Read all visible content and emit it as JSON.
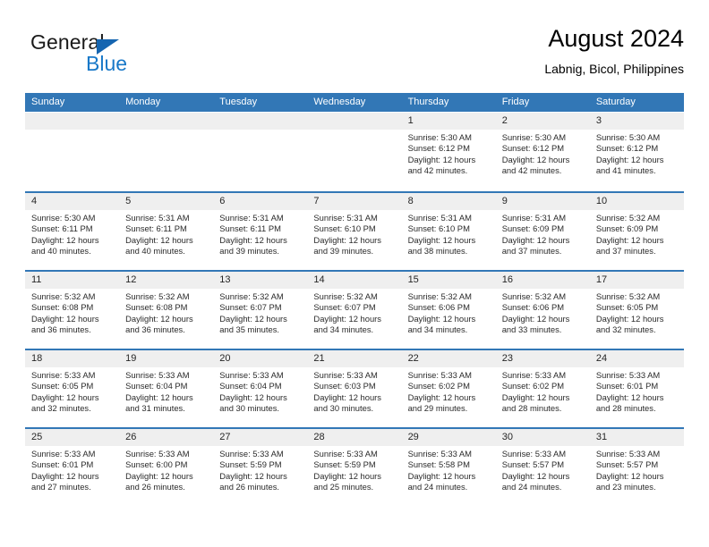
{
  "brand": {
    "word1": "General",
    "word2": "Blue",
    "triangle_icon": "triangle-icon",
    "blue": "#1878c8"
  },
  "header": {
    "title": "August 2024",
    "subtitle": "Labnig, Bicol, Philippines"
  },
  "theme": {
    "header_blue": "#3277b6",
    "day_band": "#efefef"
  },
  "weekdays": [
    "Sunday",
    "Monday",
    "Tuesday",
    "Wednesday",
    "Thursday",
    "Friday",
    "Saturday"
  ],
  "weeks": [
    [
      {
        "day": "",
        "empty": true
      },
      {
        "day": "",
        "empty": true
      },
      {
        "day": "",
        "empty": true
      },
      {
        "day": "",
        "empty": true
      },
      {
        "day": "1",
        "sunrise": "Sunrise: 5:30 AM",
        "sunset": "Sunset: 6:12 PM",
        "daylight1": "Daylight: 12 hours",
        "daylight2": "and 42 minutes."
      },
      {
        "day": "2",
        "sunrise": "Sunrise: 5:30 AM",
        "sunset": "Sunset: 6:12 PM",
        "daylight1": "Daylight: 12 hours",
        "daylight2": "and 42 minutes."
      },
      {
        "day": "3",
        "sunrise": "Sunrise: 5:30 AM",
        "sunset": "Sunset: 6:12 PM",
        "daylight1": "Daylight: 12 hours",
        "daylight2": "and 41 minutes."
      }
    ],
    [
      {
        "day": "4",
        "sunrise": "Sunrise: 5:30 AM",
        "sunset": "Sunset: 6:11 PM",
        "daylight1": "Daylight: 12 hours",
        "daylight2": "and 40 minutes."
      },
      {
        "day": "5",
        "sunrise": "Sunrise: 5:31 AM",
        "sunset": "Sunset: 6:11 PM",
        "daylight1": "Daylight: 12 hours",
        "daylight2": "and 40 minutes."
      },
      {
        "day": "6",
        "sunrise": "Sunrise: 5:31 AM",
        "sunset": "Sunset: 6:11 PM",
        "daylight1": "Daylight: 12 hours",
        "daylight2": "and 39 minutes."
      },
      {
        "day": "7",
        "sunrise": "Sunrise: 5:31 AM",
        "sunset": "Sunset: 6:10 PM",
        "daylight1": "Daylight: 12 hours",
        "daylight2": "and 39 minutes."
      },
      {
        "day": "8",
        "sunrise": "Sunrise: 5:31 AM",
        "sunset": "Sunset: 6:10 PM",
        "daylight1": "Daylight: 12 hours",
        "daylight2": "and 38 minutes."
      },
      {
        "day": "9",
        "sunrise": "Sunrise: 5:31 AM",
        "sunset": "Sunset: 6:09 PM",
        "daylight1": "Daylight: 12 hours",
        "daylight2": "and 37 minutes."
      },
      {
        "day": "10",
        "sunrise": "Sunrise: 5:32 AM",
        "sunset": "Sunset: 6:09 PM",
        "daylight1": "Daylight: 12 hours",
        "daylight2": "and 37 minutes."
      }
    ],
    [
      {
        "day": "11",
        "sunrise": "Sunrise: 5:32 AM",
        "sunset": "Sunset: 6:08 PM",
        "daylight1": "Daylight: 12 hours",
        "daylight2": "and 36 minutes."
      },
      {
        "day": "12",
        "sunrise": "Sunrise: 5:32 AM",
        "sunset": "Sunset: 6:08 PM",
        "daylight1": "Daylight: 12 hours",
        "daylight2": "and 36 minutes."
      },
      {
        "day": "13",
        "sunrise": "Sunrise: 5:32 AM",
        "sunset": "Sunset: 6:07 PM",
        "daylight1": "Daylight: 12 hours",
        "daylight2": "and 35 minutes."
      },
      {
        "day": "14",
        "sunrise": "Sunrise: 5:32 AM",
        "sunset": "Sunset: 6:07 PM",
        "daylight1": "Daylight: 12 hours",
        "daylight2": "and 34 minutes."
      },
      {
        "day": "15",
        "sunrise": "Sunrise: 5:32 AM",
        "sunset": "Sunset: 6:06 PM",
        "daylight1": "Daylight: 12 hours",
        "daylight2": "and 34 minutes."
      },
      {
        "day": "16",
        "sunrise": "Sunrise: 5:32 AM",
        "sunset": "Sunset: 6:06 PM",
        "daylight1": "Daylight: 12 hours",
        "daylight2": "and 33 minutes."
      },
      {
        "day": "17",
        "sunrise": "Sunrise: 5:32 AM",
        "sunset": "Sunset: 6:05 PM",
        "daylight1": "Daylight: 12 hours",
        "daylight2": "and 32 minutes."
      }
    ],
    [
      {
        "day": "18",
        "sunrise": "Sunrise: 5:33 AM",
        "sunset": "Sunset: 6:05 PM",
        "daylight1": "Daylight: 12 hours",
        "daylight2": "and 32 minutes."
      },
      {
        "day": "19",
        "sunrise": "Sunrise: 5:33 AM",
        "sunset": "Sunset: 6:04 PM",
        "daylight1": "Daylight: 12 hours",
        "daylight2": "and 31 minutes."
      },
      {
        "day": "20",
        "sunrise": "Sunrise: 5:33 AM",
        "sunset": "Sunset: 6:04 PM",
        "daylight1": "Daylight: 12 hours",
        "daylight2": "and 30 minutes."
      },
      {
        "day": "21",
        "sunrise": "Sunrise: 5:33 AM",
        "sunset": "Sunset: 6:03 PM",
        "daylight1": "Daylight: 12 hours",
        "daylight2": "and 30 minutes."
      },
      {
        "day": "22",
        "sunrise": "Sunrise: 5:33 AM",
        "sunset": "Sunset: 6:02 PM",
        "daylight1": "Daylight: 12 hours",
        "daylight2": "and 29 minutes."
      },
      {
        "day": "23",
        "sunrise": "Sunrise: 5:33 AM",
        "sunset": "Sunset: 6:02 PM",
        "daylight1": "Daylight: 12 hours",
        "daylight2": "and 28 minutes."
      },
      {
        "day": "24",
        "sunrise": "Sunrise: 5:33 AM",
        "sunset": "Sunset: 6:01 PM",
        "daylight1": "Daylight: 12 hours",
        "daylight2": "and 28 minutes."
      }
    ],
    [
      {
        "day": "25",
        "sunrise": "Sunrise: 5:33 AM",
        "sunset": "Sunset: 6:01 PM",
        "daylight1": "Daylight: 12 hours",
        "daylight2": "and 27 minutes."
      },
      {
        "day": "26",
        "sunrise": "Sunrise: 5:33 AM",
        "sunset": "Sunset: 6:00 PM",
        "daylight1": "Daylight: 12 hours",
        "daylight2": "and 26 minutes."
      },
      {
        "day": "27",
        "sunrise": "Sunrise: 5:33 AM",
        "sunset": "Sunset: 5:59 PM",
        "daylight1": "Daylight: 12 hours",
        "daylight2": "and 26 minutes."
      },
      {
        "day": "28",
        "sunrise": "Sunrise: 5:33 AM",
        "sunset": "Sunset: 5:59 PM",
        "daylight1": "Daylight: 12 hours",
        "daylight2": "and 25 minutes."
      },
      {
        "day": "29",
        "sunrise": "Sunrise: 5:33 AM",
        "sunset": "Sunset: 5:58 PM",
        "daylight1": "Daylight: 12 hours",
        "daylight2": "and 24 minutes."
      },
      {
        "day": "30",
        "sunrise": "Sunrise: 5:33 AM",
        "sunset": "Sunset: 5:57 PM",
        "daylight1": "Daylight: 12 hours",
        "daylight2": "and 24 minutes."
      },
      {
        "day": "31",
        "sunrise": "Sunrise: 5:33 AM",
        "sunset": "Sunset: 5:57 PM",
        "daylight1": "Daylight: 12 hours",
        "daylight2": "and 23 minutes."
      }
    ]
  ]
}
